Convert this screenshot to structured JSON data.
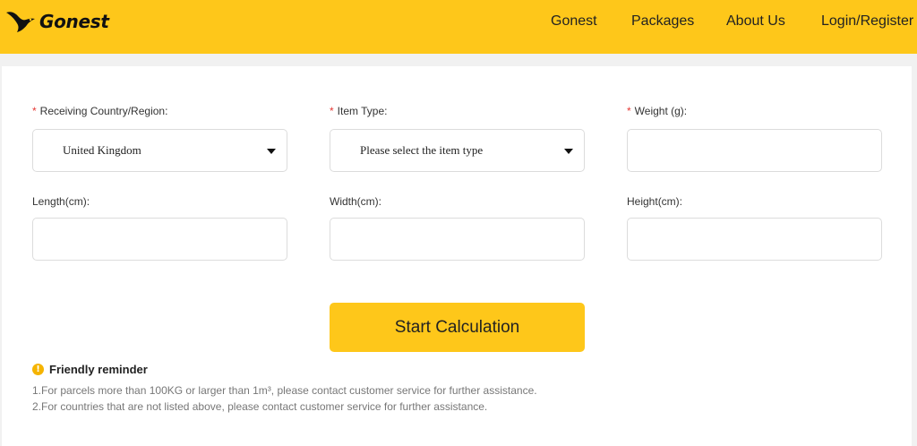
{
  "brand": {
    "name": "Gonest"
  },
  "nav": {
    "items": [
      {
        "label": "Gonest"
      },
      {
        "label": "Packages"
      },
      {
        "label": "About Us"
      },
      {
        "label": "Login/Register"
      }
    ]
  },
  "form": {
    "required_mark": "*",
    "country": {
      "label": "Receiving Country/Region:",
      "value": "United Kingdom"
    },
    "item_type": {
      "label": "Item Type:",
      "value": "Please select the item type"
    },
    "weight": {
      "label": "Weight (g):",
      "value": ""
    },
    "length": {
      "label": "Length(cm):",
      "value": ""
    },
    "width": {
      "label": "Width(cm):",
      "value": ""
    },
    "height": {
      "label": "Height(cm):",
      "value": ""
    },
    "submit_label": "Start Calculation"
  },
  "reminder": {
    "icon": "info-icon",
    "title": "Friendly reminder",
    "notes": [
      "1.For parcels more than 100KG or larger than 1m³, please contact customer service for further assistance.",
      "2.For countries that are not listed above, please contact customer service for further assistance."
    ]
  },
  "colors": {
    "brand_yellow": "#fec71a",
    "required": "#e53935",
    "note_text": "#777777"
  }
}
